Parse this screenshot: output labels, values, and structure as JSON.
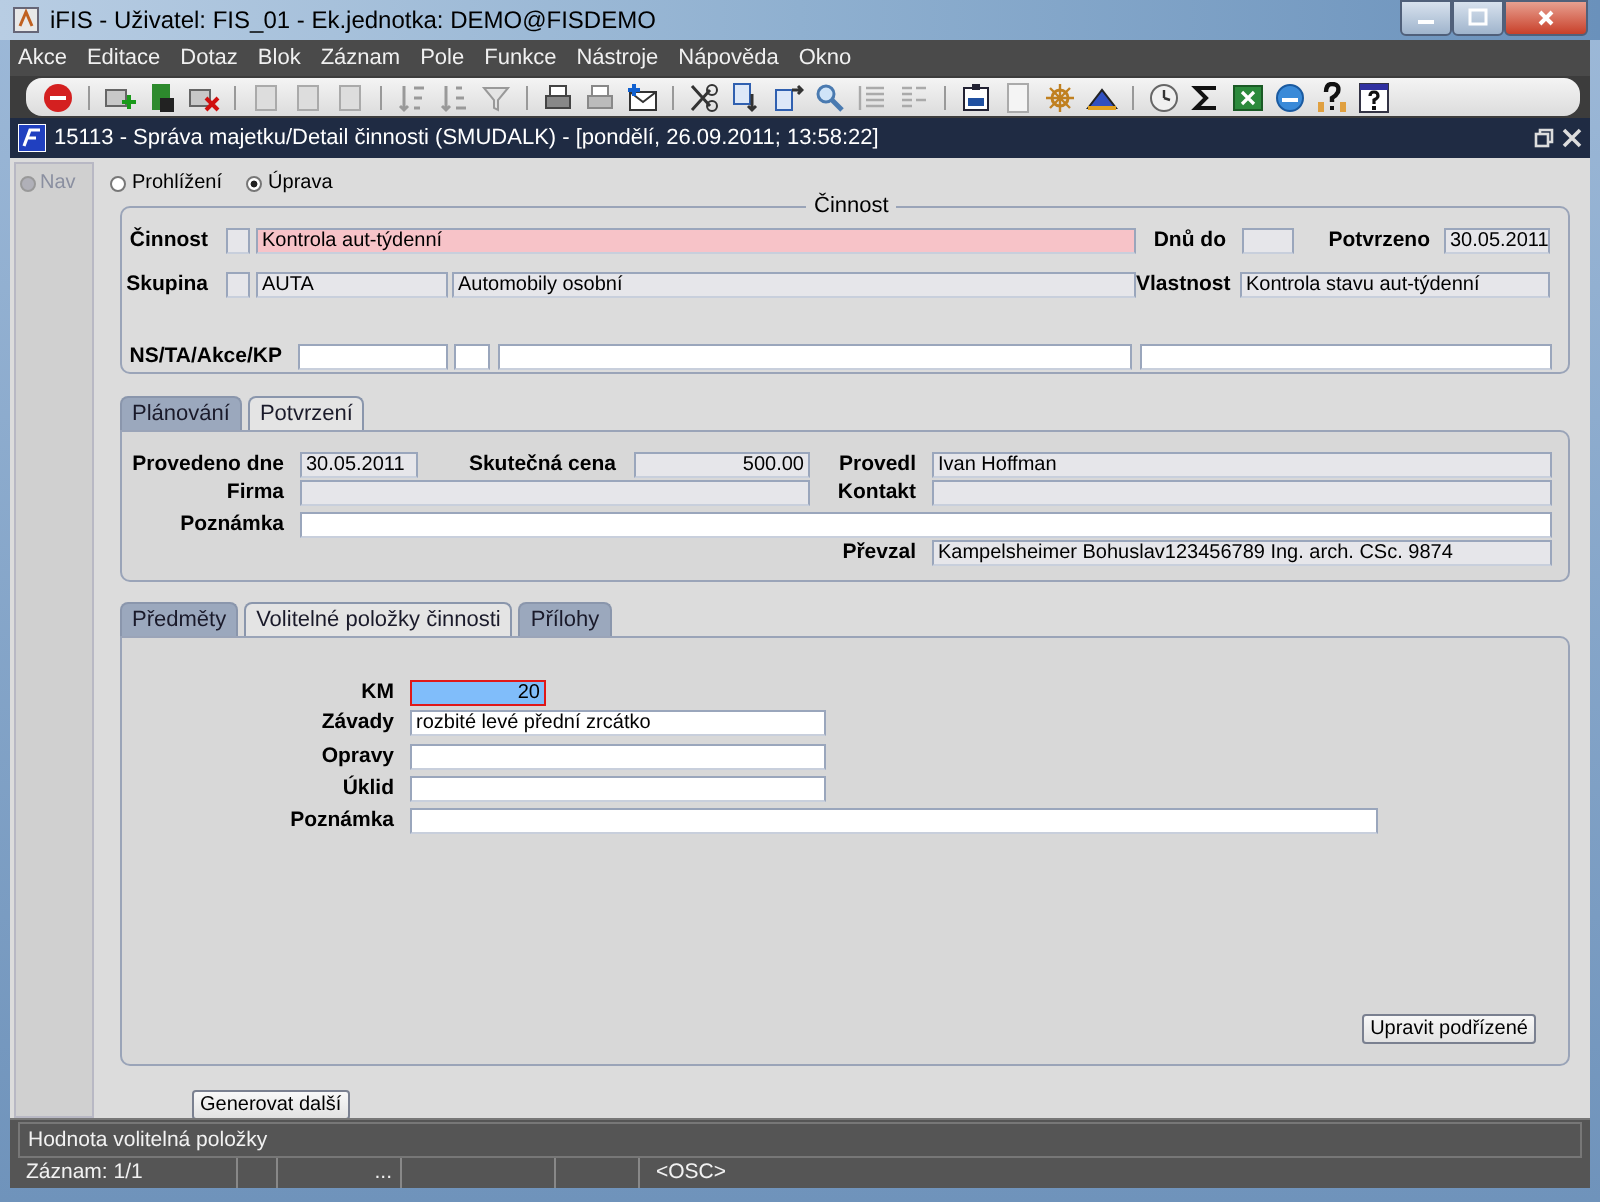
{
  "window": {
    "title": "iFIS - Uživatel: FIS_01 - Ek.jednotka: DEMO@FISDEMO"
  },
  "menu": [
    "Akce",
    "Editace",
    "Dotaz",
    "Blok",
    "Záznam",
    "Pole",
    "Funkce",
    "Nástroje",
    "Nápověda",
    "Okno"
  ],
  "form_window": {
    "title": "15113 - Správa majetku/Detail činnosti (SMUDALK) - [pondělí, 26.09.2011; 13:58:22]"
  },
  "nav": {
    "label": "Nav",
    "disabled": true
  },
  "mode_options": [
    {
      "label": "Prohlížení",
      "selected": false
    },
    {
      "label": "Úprava",
      "selected": true
    }
  ],
  "activity": {
    "title": "Činnost",
    "rows": [
      [
        {
          "kind": "label",
          "text": "Činnost"
        },
        {
          "kind": "readonly_field",
          "focused": false
        },
        {
          "kind": "required_field",
          "focused": false,
          "value": "Kontrola aut-týdenní"
        },
        "",
        {
          "kind": "label",
          "text": "Dnů do"
        },
        {
          "kind": "readonly_field",
          "focused": false
        },
        {
          "kind": "label",
          "text": "Potvrzeno"
        },
        {
          "kind": "readonly_field",
          "focused": false,
          "value": "30.05.2011"
        }
      ],
      [
        {
          "kind": "label",
          "text": "Skupina"
        },
        {
          "kind": "readonly_field",
          "focused": false
        },
        {
          "kind": "readonly_field",
          "focused": false,
          "value": "AUTA"
        },
        {
          "kind": "readonly_field",
          "focused": false,
          "value": "Automobily osobní"
        },
        {
          "kind": "label",
          "text": "Vlastnost"
        },
        {
          "kind": "readonly_field",
          "focused": false,
          "value": "Kontrola stavu aut-týdenní"
        }
      ],
      [
        {
          "kind": "label",
          "text": "NS/TA/Akce/KP"
        },
        {
          "kind": "input_field",
          "focused": false
        },
        {
          "kind": "input_field",
          "focused": false
        },
        {
          "kind": "input_field",
          "focused": false
        },
        {
          "kind": "input_field",
          "focused": false
        }
      ]
    ]
  },
  "tabs_top": {
    "tabs": [
      {
        "label": "Plánování",
        "selected": false
      },
      {
        "label": "Potvrzení",
        "selected": true
      }
    ],
    "rows": [
      [
        {
          "kind": "label",
          "text": "Provedeno dne"
        },
        {
          "kind": "readonly_field",
          "focused": false,
          "value": "30.05.2011"
        },
        {
          "kind": "label",
          "text": "Skutečná cena"
        },
        {
          "kind": "readonly_number",
          "focused": false,
          "value": "500.00"
        },
        {
          "kind": "label",
          "text": "Provedl"
        },
        {
          "kind": "readonly_field",
          "focused": false,
          "value": "Ivan Hoffman"
        }
      ],
      [
        {
          "kind": "label",
          "text": "Firma"
        },
        {
          "kind": "readonly_field",
          "focused": false
        },
        "",
        "",
        {
          "kind": "label",
          "text": "Kontakt"
        },
        {
          "kind": "readonly_field",
          "focused": false
        }
      ],
      [
        {
          "kind": "label",
          "text": "Poznámka"
        },
        {
          "kind": "input_field",
          "focused": false
        }
      ],
      [
        "",
        "",
        "",
        "",
        {
          "kind": "label",
          "text": "Převzal"
        },
        {
          "kind": "readonly_field",
          "focused": false,
          "value": "Kampelsheimer Bohuslav123456789 Ing. arch. CSc. 9874"
        }
      ]
    ]
  },
  "tabs_bottom": {
    "tabs": [
      {
        "label": "Předměty",
        "selected": false
      },
      {
        "label": "Volitelné položky činnosti",
        "selected": true
      },
      {
        "label": "Přílohy",
        "selected": false
      }
    ],
    "rows": [
      [
        {
          "kind": "label",
          "text": "KM"
        },
        {
          "kind": "input_number",
          "focused": true,
          "value": "20"
        }
      ],
      [
        {
          "kind": "label",
          "text": "Závady"
        },
        {
          "kind": "input_field",
          "focused": false,
          "value": "rozbité levé přední zrcátko"
        }
      ],
      [
        {
          "kind": "label",
          "text": "Opravy"
        },
        {
          "kind": "input_field",
          "focused": false
        }
      ],
      [
        {
          "kind": "label",
          "text": "Úklid"
        },
        {
          "kind": "input_field",
          "focused": false
        }
      ],
      [
        {
          "kind": "label",
          "text": "Poznámka"
        },
        {
          "kind": "input_field",
          "focused": false
        }
      ]
    ],
    "button": "Upravit podřízené"
  },
  "generate_button": "Generovat další",
  "status_bar": {
    "message": "Hodnota volitelná položky",
    "record": "Záznam: 1/1",
    "segment": "...",
    "mode": "<OSC>"
  }
}
